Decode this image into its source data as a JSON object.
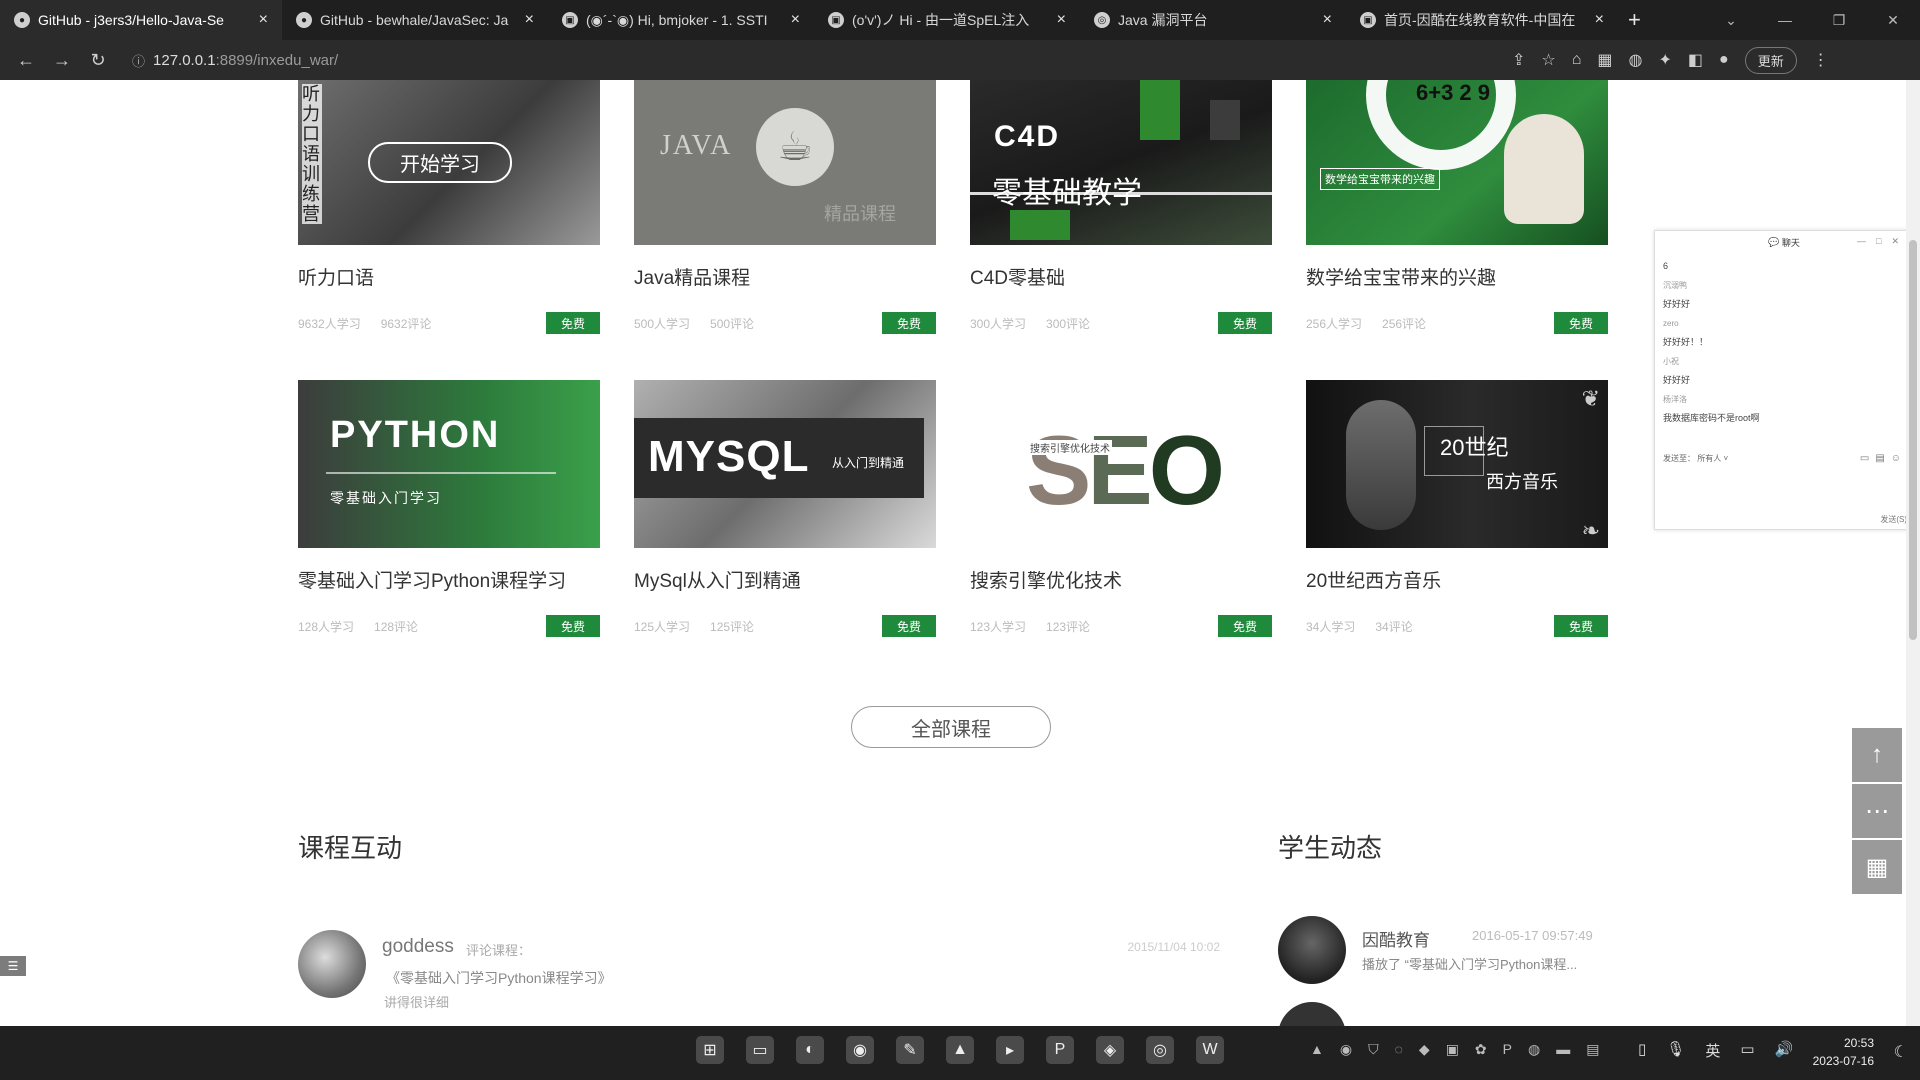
{
  "browser": {
    "tabs": [
      {
        "icon": "github-icon",
        "title": "GitHub - j3ers3/Hello-Java-Se",
        "active": true
      },
      {
        "icon": "github-icon",
        "title": "GitHub - bewhale/JavaSec: Ja"
      },
      {
        "icon": "page-icon",
        "title": "(◉´-`◉) Hi, bmjoker - 1. SSTI"
      },
      {
        "icon": "page-icon",
        "title": "(o'v')ノ Hi - 由一道SpEL注入"
      },
      {
        "icon": "globe-icon",
        "title": "Java 漏洞平台"
      },
      {
        "icon": "page-icon",
        "title": "首页-因酷在线教育软件-中国在"
      }
    ],
    "url_host": "127.0.0.1",
    "url_path": ":8899/inxedu_war/",
    "update_label": "更新"
  },
  "courses": [
    {
      "title": "听力口语",
      "learners": "9632人学习",
      "comments": "9632评论",
      "badge": "免费",
      "thumb": {
        "vertical_text": "听力口语训练营",
        "button": "开始学习"
      }
    },
    {
      "title": "Java精品课程",
      "learners": "500人学习",
      "comments": "500评论",
      "badge": "免费",
      "thumb": {
        "text": "JAVA",
        "sub": "精品课程"
      }
    },
    {
      "title": "C4D零基础",
      "learners": "300人学习",
      "comments": "300评论",
      "badge": "免费",
      "thumb": {
        "text": "C4D",
        "sub": "零基础教学"
      }
    },
    {
      "title": "数学给宝宝带来的兴趣",
      "learners": "256人学习",
      "comments": "256评论",
      "badge": "免费",
      "thumb": {
        "text": "6+3 2 9",
        "sub": "数学给宝宝带来的兴趣"
      }
    },
    {
      "title": "零基础入门学习Python课程学习",
      "learners": "128人学习",
      "comments": "128评论",
      "badge": "免费",
      "thumb": {
        "text": "PYTHON",
        "sub": "零基础入门学习"
      }
    },
    {
      "title": "MySql从入门到精通",
      "learners": "125人学习",
      "comments": "125评论",
      "badge": "免费",
      "thumb": {
        "text": "MYSQL",
        "sub": "从入门到精通"
      }
    },
    {
      "title": "搜索引擎优化技术",
      "learners": "123人学习",
      "comments": "123评论",
      "badge": "免费",
      "thumb": {
        "text": "SEO",
        "sub": "搜索引擎优化技术"
      }
    },
    {
      "title": "20世纪西方音乐",
      "learners": "34人学习",
      "comments": "34评论",
      "badge": "免费",
      "thumb": {
        "text": "20世纪",
        "sub": "西方音乐"
      }
    }
  ],
  "all_courses_label": "全部课程",
  "interaction": {
    "title": "课程互动",
    "comment": {
      "user": "goddess",
      "action": "评论课程：",
      "time": "2015/11/04 10:02",
      "course": "《零基础入门学习Python课程学习》",
      "text": "讲得很详细"
    }
  },
  "student_news": {
    "title": "学生动态",
    "item": {
      "user": "因酷教育",
      "time": "2016-05-17 09:57:49",
      "text": "播放了 “零基础入门学习Python课程..."
    }
  },
  "chat": {
    "title": "聊天",
    "messages": [
      "6",
      "沉溺鸭",
      "好好好",
      "zero",
      "好好好！！",
      "小祝",
      "好好好",
      "杨洋洛",
      "我数据库密码不是root啊"
    ],
    "send_to_label": "发送至：",
    "send_to_value": "所有人",
    "send_label": "发送(S)"
  },
  "taskbar": {
    "ime": "英",
    "time": "20:53",
    "date": "2023-07-16"
  }
}
